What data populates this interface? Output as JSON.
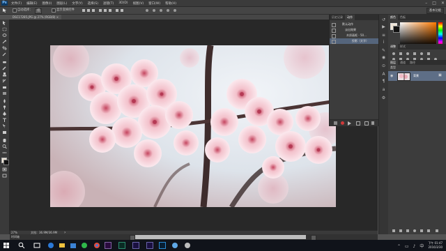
{
  "app": {
    "logo": "Ps"
  },
  "menubar": {
    "items": [
      "文件(F)",
      "编辑(E)",
      "图像(I)",
      "图层(L)",
      "文字(Y)",
      "选择(S)",
      "滤镜(T)",
      "3D(D)",
      "视图(V)",
      "窗口(W)",
      "帮助(H)"
    ],
    "window_controls": [
      "–",
      "□",
      "✕"
    ]
  },
  "options_bar": {
    "auto_select_label": "自动选择：",
    "auto_select_value": "组",
    "show_transform_label": "显示变换控件",
    "workspace": "基本功能"
  },
  "document": {
    "tab_title": "DSC17285.JPG @ 27% (RGB/8) ×",
    "zoom": "27%",
    "doc_info": "文档：36.9M/36.9M"
  },
  "history_panel": {
    "tabs": [
      "历史记录",
      "动作"
    ],
    "rows": [
      "默认动作",
      "淡出效果",
      "木质画框 - 50...",
      "投影（文字）"
    ],
    "footer_icons": [
      "stop-icon",
      "record-icon",
      "play-icon",
      "new-set-icon",
      "new-action-icon",
      "delete-icon"
    ]
  },
  "color_panel": {
    "tabs": [
      "颜色",
      "色板"
    ],
    "fg": "#efe6d8",
    "bg": "#111111"
  },
  "adjustments_panel": {
    "tabs": [
      "调整",
      "样式"
    ]
  },
  "layers_panel": {
    "tabs": [
      "图层",
      "通道",
      "路径"
    ],
    "kind_label": "类型",
    "blend_mode": "正常",
    "opacity_label": "不透明度：",
    "lock_label": "锁定：",
    "fill_label": "填充：",
    "layer_name": "背景"
  },
  "timeline": {
    "label": "时间轴"
  },
  "taskbar": {
    "time": "下午 01:47",
    "date": "2016/3/30"
  },
  "colors": {
    "menubar": "#3b3b3b",
    "panel": "#3c3c3c",
    "selected_layer": "#5e6e86",
    "canvas_bg": "#282828"
  }
}
